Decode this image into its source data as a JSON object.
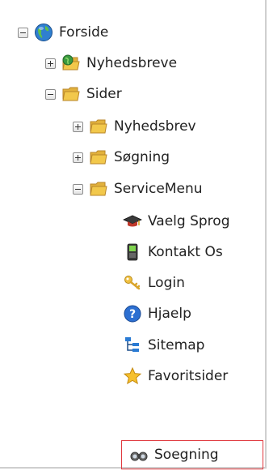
{
  "tree": {
    "nodes": [
      {
        "label": "Forside",
        "toggle": "minus",
        "icon": "globe-icon"
      },
      {
        "label": "Nyhedsbreve",
        "toggle": "plus",
        "icon": "folder-globe-icon"
      },
      {
        "label": "Sider",
        "toggle": "minus",
        "icon": "folder-icon"
      },
      {
        "label": "Nyhedsbrev",
        "toggle": "plus",
        "icon": "folder-icon"
      },
      {
        "label": "Søgning",
        "toggle": "plus",
        "icon": "folder-icon"
      },
      {
        "label": "ServiceMenu",
        "toggle": "minus",
        "icon": "folder-icon"
      },
      {
        "label": "Vaelg Sprog",
        "icon": "graduation-cap-icon"
      },
      {
        "label": "Kontakt Os",
        "icon": "mobile-phone-icon"
      },
      {
        "label": "Login",
        "icon": "key-icon"
      },
      {
        "label": "Hjaelp",
        "icon": "help-icon"
      },
      {
        "label": "Sitemap",
        "icon": "sitemap-icon"
      },
      {
        "label": "Favoritsider",
        "icon": "star-icon"
      },
      {
        "label": "Soegning",
        "icon": "binoculars-icon",
        "selected": true
      }
    ]
  },
  "colors": {
    "folder": "#f2c84b",
    "selection_border": "#e0393e",
    "globe": "#2f7fd0",
    "help": "#2c6fd1"
  }
}
